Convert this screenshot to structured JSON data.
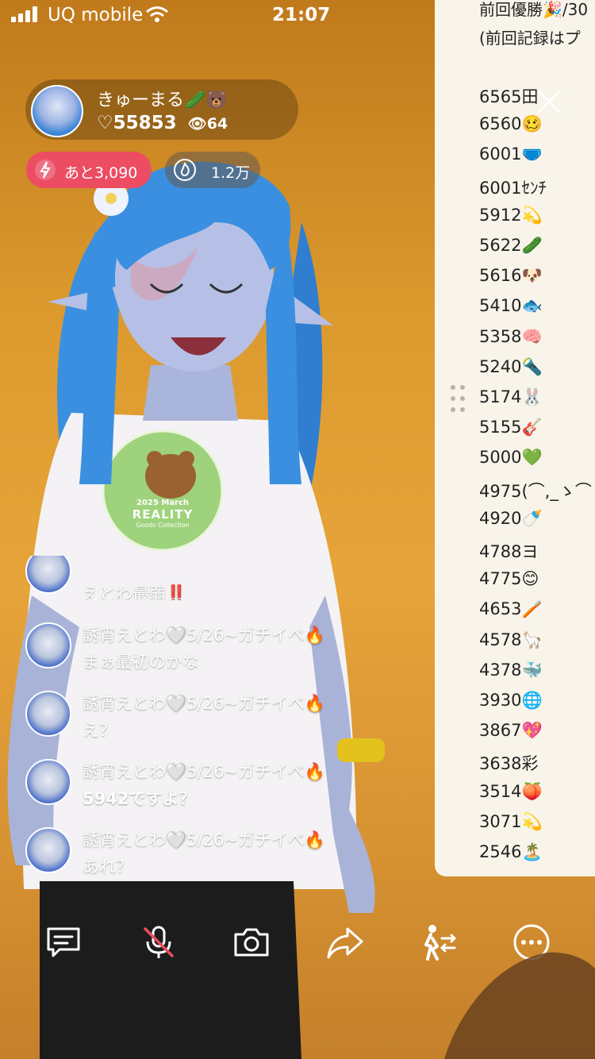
{
  "status_bar": {
    "carrier": "UQ mobile",
    "time": "21:07"
  },
  "host": {
    "name": "きゅーまる🥒🐻",
    "likes": "♡55853",
    "viewers": "👁64"
  },
  "badges": {
    "points_label": "あと3,090",
    "fans_label": "1.2万"
  },
  "ranking": {
    "header_line1": "前回優勝🎉/30",
    "header_line2": "(前回記録はプ",
    "entries": [
      {
        "score": "6565",
        "tag": "田"
      },
      {
        "score": "6560",
        "tag": "🥴"
      },
      {
        "score": "6001",
        "tag": "🩲"
      },
      {
        "score": "6001",
        "tag": "ｾﾝﾁ"
      },
      {
        "score": "5912",
        "tag": "💫"
      },
      {
        "score": "5622",
        "tag": "🥒"
      },
      {
        "score": "5616",
        "tag": "🐶"
      },
      {
        "score": "5410",
        "tag": "🐟"
      },
      {
        "score": "5358",
        "tag": "🧠"
      },
      {
        "score": "5240",
        "tag": "🔦"
      },
      {
        "score": "5174",
        "tag": "🐰"
      },
      {
        "score": "5155",
        "tag": "🎸"
      },
      {
        "score": "5000",
        "tag": "💚"
      },
      {
        "score": "4975",
        "tag": "(⌒,_ゝ⌒"
      },
      {
        "score": "4920",
        "tag": "🍼"
      },
      {
        "score": "4788",
        "tag": "ヨ"
      },
      {
        "score": "4775",
        "tag": "😊"
      },
      {
        "score": "4653",
        "tag": "🪥"
      },
      {
        "score": "4578",
        "tag": "🦙"
      },
      {
        "score": "4378",
        "tag": "🐳"
      },
      {
        "score": "3930",
        "tag": "🌐"
      },
      {
        "score": "3867",
        "tag": "💖"
      },
      {
        "score": "3638",
        "tag": "彩"
      },
      {
        "score": "3514",
        "tag": "🍑"
      },
      {
        "score": "3071",
        "tag": "💫"
      },
      {
        "score": "2546",
        "tag": "🏝️"
      }
    ]
  },
  "chat": [
    {
      "name": "",
      "message": "えとわ最弱‼️"
    },
    {
      "name": "誘宵えとわ🤍5/26~ガチイベ🔥",
      "message": "まぁ最初のかな"
    },
    {
      "name": "誘宵えとわ🤍5/26~ガチイベ🔥",
      "message": "え？"
    },
    {
      "name": "誘宵えとわ🤍5/26~ガチイベ🔥",
      "message": "5942ですよ？"
    },
    {
      "name": "誘宵えとわ🤍5/26~ガチイベ🔥",
      "message": "あれ？"
    }
  ],
  "shirt_badge": {
    "line1": "2025 March",
    "line2": "REALITY",
    "line3": "Goods Collection"
  },
  "toolbar": {
    "icons": [
      "chat-icon",
      "mic-muted-icon",
      "camera-icon",
      "share-icon",
      "collab-icon",
      "more-icon"
    ]
  },
  "colors": {
    "background": "#dc9a2e",
    "red_pill": "#ec4d63",
    "hair": "#3a8fe0",
    "panel": "#f8f4ea"
  }
}
